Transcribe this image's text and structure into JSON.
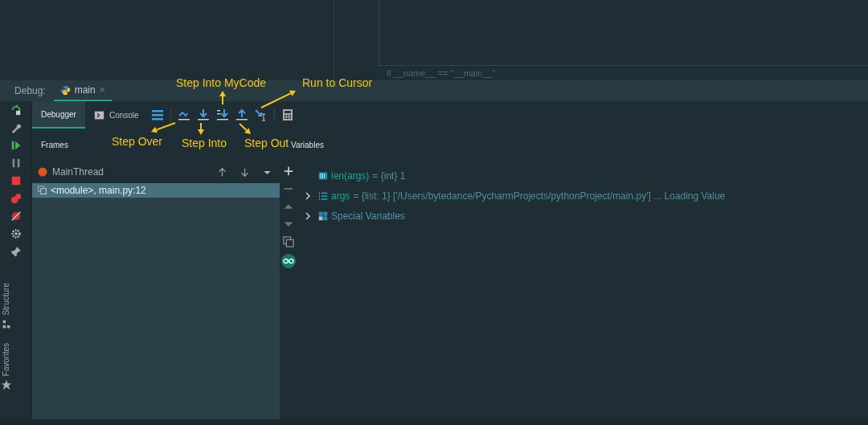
{
  "editor": {
    "code_line": "if __name__ == \"__main__\""
  },
  "debug_bar": {
    "label": "Debug:",
    "tabs": [
      {
        "label": "main",
        "selected": true,
        "close": "×"
      }
    ]
  },
  "tool_windows": [
    {
      "label": "Structure"
    },
    {
      "label": "Favorites"
    }
  ],
  "tabs": [
    {
      "label": "Debugger",
      "selected": true
    },
    {
      "label": "Console",
      "selected": false
    }
  ],
  "panels": {
    "frames": "Frames",
    "variables": "Variables"
  },
  "thread": {
    "name": "MainThread"
  },
  "frames": [
    {
      "label": "<module>, main.py:12",
      "selected": true
    }
  ],
  "variables": [
    {
      "kind": "int",
      "name": "len(args)",
      "value": "= {int} 1",
      "expandable": false
    },
    {
      "kind": "list",
      "name": "args",
      "value": "= {list: 1} ['/Users/bytedance/PycharmProjects/pythonProject/main.py'] ... Loading Value",
      "expandable": true
    },
    {
      "kind": "special",
      "name": "Special Variables",
      "expandable": true
    }
  ],
  "annotations": [
    {
      "text": "Step Into MyCode"
    },
    {
      "text": "Run to Cursor"
    },
    {
      "text": "Step Over"
    },
    {
      "text": "Step Into"
    },
    {
      "text": "Step Out"
    }
  ]
}
